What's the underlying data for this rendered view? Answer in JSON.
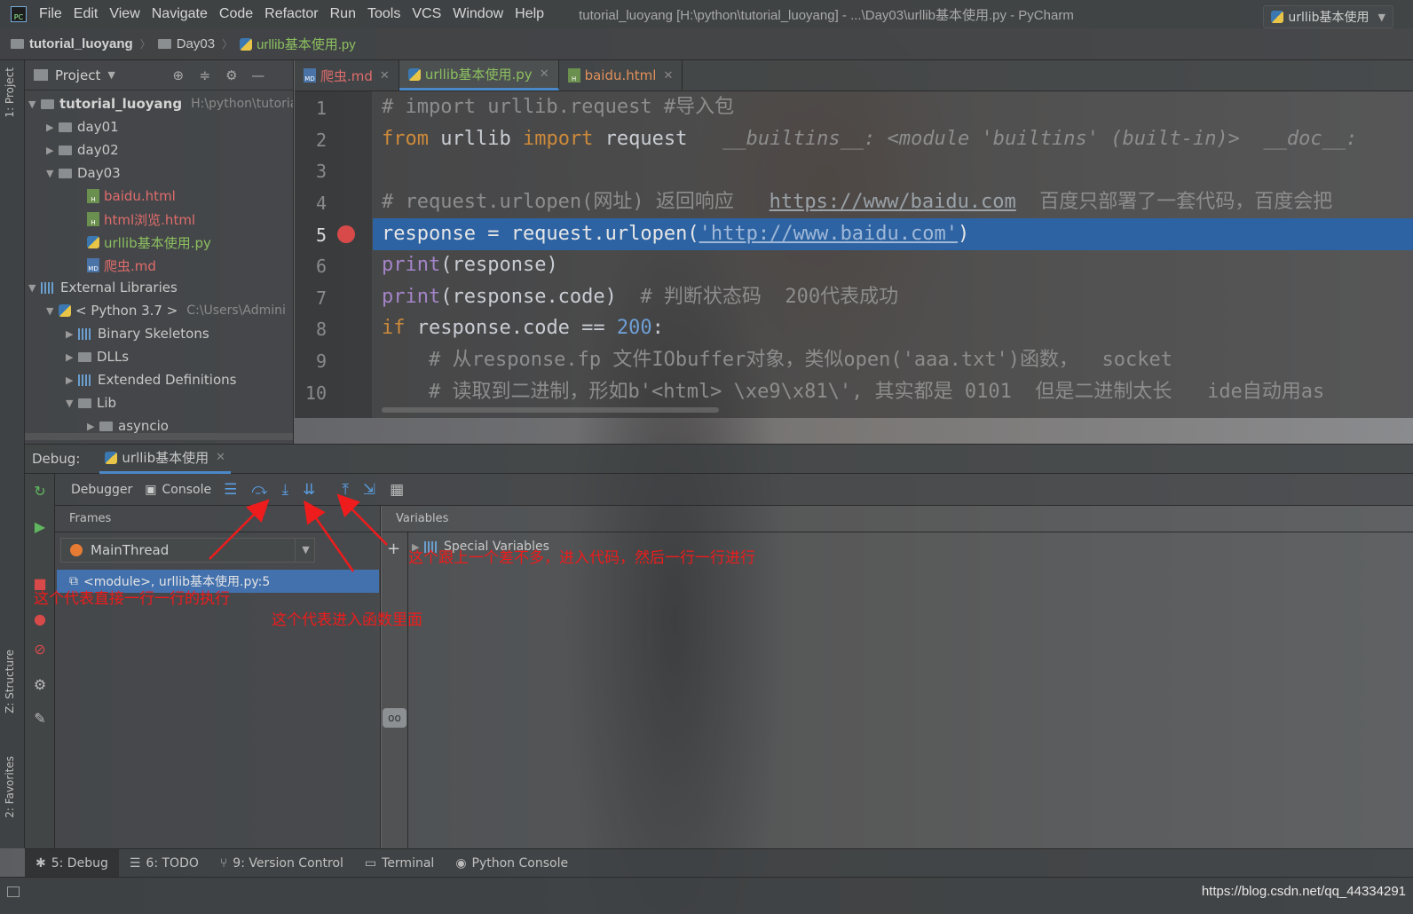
{
  "app": {
    "logo_text": "PC",
    "menu": [
      "File",
      "Edit",
      "View",
      "Navigate",
      "Code",
      "Refactor",
      "Run",
      "Tools",
      "VCS",
      "Window",
      "Help"
    ],
    "window_title": "tutorial_luoyang [H:\\python\\tutorial_luoyang] - ...\\Day03\\urllib基本使用.py - PyCharm"
  },
  "breadcrumb": [
    "tutorial_luoyang",
    "Day03",
    "urllib基本使用.py"
  ],
  "run_config": "urllib基本使用",
  "left_strip": {
    "project_tab": "1: Project",
    "structure_tab": "Z: Structure",
    "favorites_tab": "2: Favorites"
  },
  "project": {
    "header": "Project",
    "root": {
      "name": "tutorial_luoyang",
      "path": "H:\\python\\tutoria"
    },
    "items": [
      "day01",
      "day02",
      "Day03",
      "baidu.html",
      "html浏览.html",
      "urllib基本使用.py",
      "爬虫.md",
      "External Libraries"
    ],
    "python": {
      "name": "< Python 3.7 >",
      "path": "C:\\Users\\Admini"
    },
    "libs": [
      "Binary Skeletons",
      "DLLs",
      "Extended Definitions",
      "Lib",
      "asyncio"
    ]
  },
  "tabs": [
    "爬虫.md",
    "urllib基本使用.py",
    "baidu.html"
  ],
  "editor": {
    "line_numbers": [
      "1",
      "2",
      "3",
      "4",
      "5",
      "6",
      "7",
      "8",
      "9",
      "10"
    ],
    "l1": "# import urllib.request #导入包",
    "l2_from": "from",
    "l2_mod": " urllib ",
    "l2_import": "import",
    "l2_name": " request",
    "l2_hint": "   __builtins__: <module 'builtins' (built-in)>  __doc__:",
    "l4_a": "# request.urlopen(网址) 返回响应   ",
    "l4_url": "https://www/baidu.com",
    "l4_b": "  百度只部署了一套代码，百度会把",
    "l5_a": "response = request.urlopen(",
    "l5_str": "'http://www.baidu.com'",
    "l5_b": ")",
    "l6_fn": "print",
    "l6_rest": "(response)",
    "l7_fn": "print",
    "l7_rest": "(response.code)",
    "l7_cm": "  # 判断状态码  200代表成功",
    "l8_kw": "if",
    "l8_rest": " response.code == ",
    "l8_num": "200",
    "l8_end": ":",
    "l9": "    # 从response.fp 文件IObuffer对象，类似open('aaa.txt')函数，  socket",
    "l10": "    # 读取到二进制，形如b'<html> \\xe9\\x81\\', 其实都是 0101  但是二进制太长   ide自动用as"
  },
  "debug": {
    "label": "Debug:",
    "session": "urllib基本使用",
    "debugger_tab": "Debugger",
    "console_tab": "Console",
    "frames_title": "Frames",
    "variables_title": "Variables",
    "thread": "MainThread",
    "frame": "<module>, urllib基本使用.py:5",
    "special_variables": "Special Variables"
  },
  "annotations": {
    "step_over": "这个代表直接一行一行的执行",
    "step_into": "这个代表进入函数里面",
    "step_into_my_code": "这个跟上一个差不多，进入代码，然后一行一行进行"
  },
  "bottom_tools": [
    "5: Debug",
    "6: TODO",
    "9: Version Control",
    "Terminal",
    "Python Console"
  ],
  "watermark": "https://blog.csdn.net/qq_44334291",
  "colors": {
    "accent": "#4a88c7",
    "exec_line": "#2d63a3",
    "breakpoint": "#d84a4a",
    "annotation": "#ee1c1c"
  }
}
